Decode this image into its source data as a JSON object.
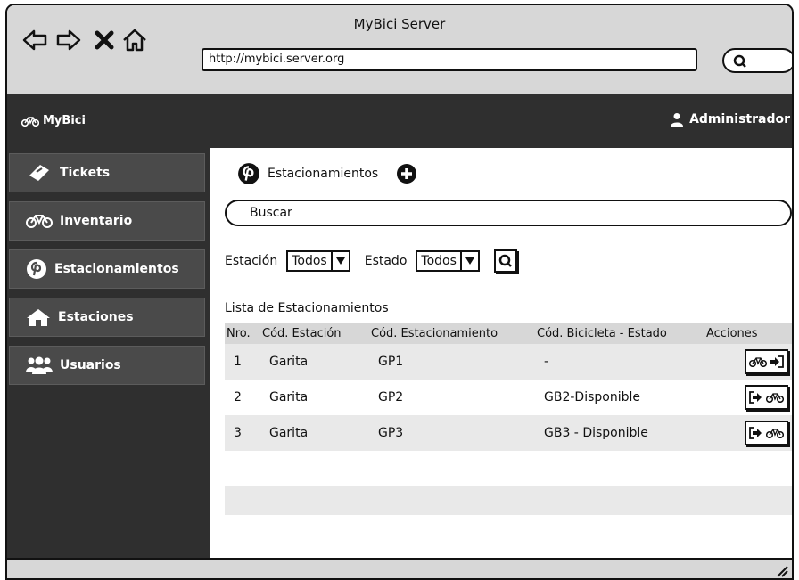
{
  "browser": {
    "title": "MyBici Server",
    "url": "http://mybici.server.org"
  },
  "app": {
    "brand": "MyBici",
    "user": "Administrador"
  },
  "sidebar": {
    "items": [
      {
        "label": "Tickets",
        "icon": "ticket-icon"
      },
      {
        "label": "Inventario",
        "icon": "bicycle-icon"
      },
      {
        "label": "Estacionamientos",
        "icon": "pinterest-icon"
      },
      {
        "label": "Estaciones",
        "icon": "home-icon"
      },
      {
        "label": "Usuarios",
        "icon": "users-icon"
      }
    ]
  },
  "main": {
    "header": "Estacionamientos",
    "search_placeholder": "Buscar",
    "filters": {
      "station_label": "Estación",
      "station_value": "Todos",
      "status_label": "Estado",
      "status_value": "Todos"
    },
    "list_title": "Lista de Estacionamientos",
    "table": {
      "headers": [
        "Nro.",
        "Cód. Estación",
        "Cód. Estacionamiento",
        "Cód. Bicicleta - Estado",
        "Acciones"
      ],
      "rows": [
        {
          "nro": "1",
          "station": "Garita",
          "parking": "GP1",
          "bike": "-"
        },
        {
          "nro": "2",
          "station": "Garita",
          "parking": "GP2",
          "bike": "GB2-Disponible"
        },
        {
          "nro": "3",
          "station": "Garita",
          "parking": "GP3",
          "bike": "GB3 - Disponible"
        }
      ]
    }
  }
}
